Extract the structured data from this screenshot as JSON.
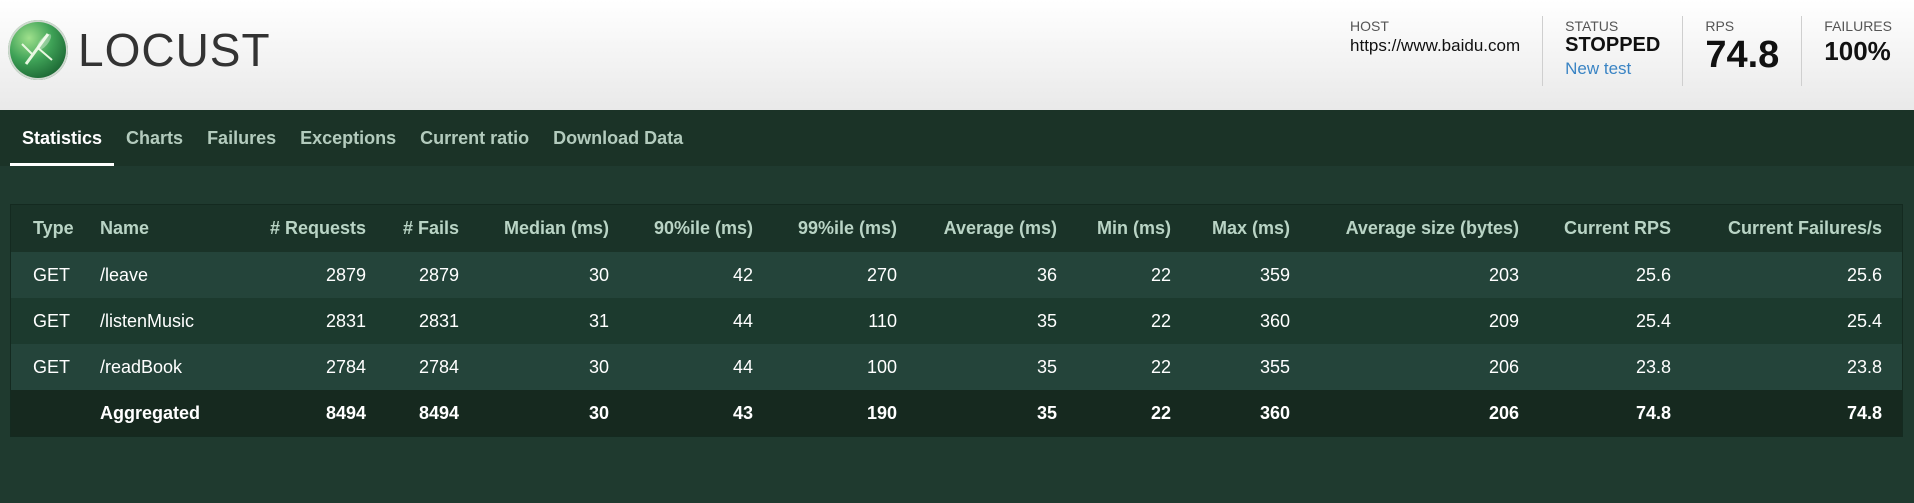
{
  "app": {
    "logo_text": "LOCUST"
  },
  "header": {
    "host_label": "HOST",
    "host_value": "https://www.baidu.com",
    "status_label": "STATUS",
    "status_value": "STOPPED",
    "new_test_label": "New test",
    "rps_label": "RPS",
    "rps_value": "74.8",
    "failures_label": "FAILURES",
    "failures_value": "100%"
  },
  "tabs": [
    {
      "label": "Statistics",
      "active": true
    },
    {
      "label": "Charts",
      "active": false
    },
    {
      "label": "Failures",
      "active": false
    },
    {
      "label": "Exceptions",
      "active": false
    },
    {
      "label": "Current ratio",
      "active": false
    },
    {
      "label": "Download Data",
      "active": false
    }
  ],
  "table": {
    "columns": [
      "Type",
      "Name",
      "# Requests",
      "# Fails",
      "Median (ms)",
      "90%ile (ms)",
      "99%ile (ms)",
      "Average (ms)",
      "Min (ms)",
      "Max (ms)",
      "Average size (bytes)",
      "Current RPS",
      "Current Failures/s"
    ],
    "rows": [
      [
        "GET",
        "/leave",
        "2879",
        "2879",
        "30",
        "42",
        "270",
        "36",
        "22",
        "359",
        "203",
        "25.6",
        "25.6"
      ],
      [
        "GET",
        "/listenMusic",
        "2831",
        "2831",
        "31",
        "44",
        "110",
        "35",
        "22",
        "360",
        "209",
        "25.4",
        "25.4"
      ],
      [
        "GET",
        "/readBook",
        "2784",
        "2784",
        "30",
        "44",
        "100",
        "35",
        "22",
        "355",
        "206",
        "23.8",
        "23.8"
      ]
    ],
    "aggregated": [
      "",
      "Aggregated",
      "8494",
      "8494",
      "30",
      "43",
      "190",
      "35",
      "22",
      "360",
      "206",
      "74.8",
      "74.8"
    ]
  },
  "colors": {
    "header_bg": "#f2f2f2",
    "page_bg": "#1f3a2f",
    "tab_bar_bg": "#1b3327",
    "link": "#3a84c4"
  }
}
